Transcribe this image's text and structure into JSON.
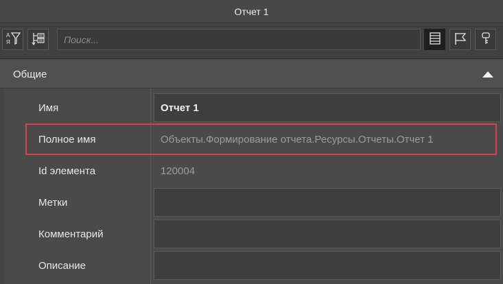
{
  "window": {
    "title": "Отчет 1"
  },
  "toolbar": {
    "sort_alpha_icon": "sort-alpha-filter-icon",
    "sort_tree_icon": "sort-tree-icon",
    "search_placeholder": "Поиск...",
    "list_view_icon": "list-view-icon",
    "flag_icon": "flag-icon",
    "key_icon": "key-icon"
  },
  "group": {
    "title": "Общие",
    "state": "expanded"
  },
  "properties": [
    {
      "label": "Имя",
      "value": "Отчет 1"
    },
    {
      "label": "Полное имя",
      "value": "Объекты.Формирование отчета.Ресурсы.Отчеты.Отчет 1"
    },
    {
      "label": "Id элемента",
      "value": "120004"
    },
    {
      "label": "Метки",
      "value": ""
    },
    {
      "label": "Комментарий",
      "value": ""
    },
    {
      "label": "Описание",
      "value": ""
    }
  ],
  "colors": {
    "highlight": "#d9434b",
    "background": "#4a4a4a"
  }
}
